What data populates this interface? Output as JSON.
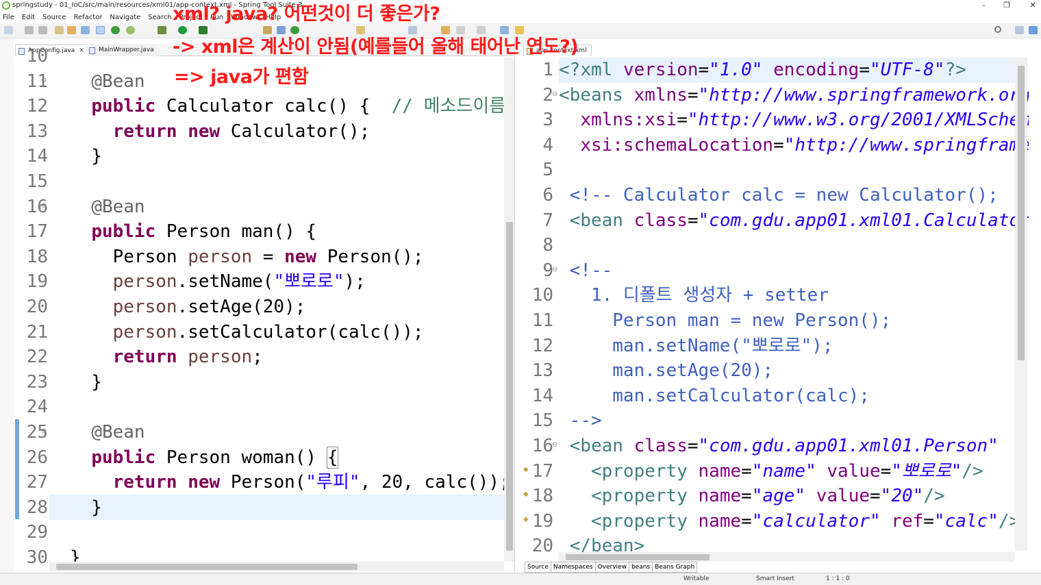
{
  "window": {
    "title": "springstudy - 01_IoC/src/main/resources/xml01/app-context.xml - Spring Tool Suite 3",
    "minimize": "–",
    "maximize": "❐",
    "close": "✕"
  },
  "menu": [
    "File",
    "Edit",
    "Source",
    "Refactor",
    "Navigate",
    "Search",
    "Project",
    "Run",
    "Window",
    "Help"
  ],
  "overlay": {
    "line1": "xml? java? 어떤것이 더 좋은가?",
    "line2": "-> xml은 계산이 안됨(예를들어 올해 태어난 연도?)",
    "line3": "=> java가 편함"
  },
  "left_editor": {
    "tabs": [
      {
        "label": "AppConfig.java",
        "close": "✕"
      },
      {
        "label": "MainWrapper.java"
      }
    ],
    "line_numbers": [
      "10",
      "11",
      "12",
      "13",
      "14",
      "15",
      "16",
      "17",
      "18",
      "19",
      "20",
      "21",
      "22",
      "23",
      "24",
      "25",
      "26",
      "27",
      "28",
      "29",
      "30"
    ]
  },
  "right_editor": {
    "tabs": [
      {
        "label": "app-context.xml"
      }
    ],
    "line_numbers": [
      "1",
      "2",
      "3",
      "4",
      "5",
      "6",
      "7",
      "8",
      "9",
      "10",
      "11",
      "12",
      "13",
      "14",
      "15",
      "16",
      "17",
      "18",
      "19",
      "20"
    ],
    "bottom_tabs": [
      "Source",
      "Namespaces",
      "Overview",
      "beans",
      "Beans Graph"
    ]
  },
  "status": {
    "writable": "Writable",
    "insert_mode": "Smart Insert",
    "position": "1 : 1 : 0"
  },
  "colors": {
    "overlay_text": "#ff1a1a",
    "keyword": "#7f0055",
    "string": "#2a00ff",
    "xml_tag": "#3f7f7f",
    "xml_attr": "#7f007f"
  }
}
